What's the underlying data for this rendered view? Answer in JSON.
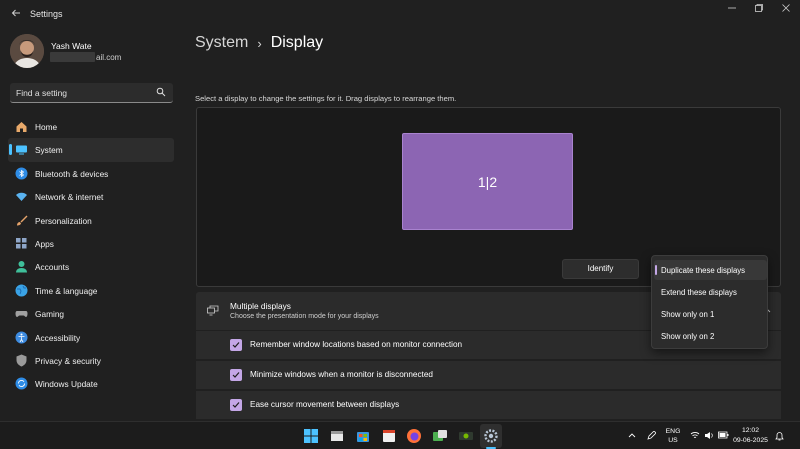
{
  "window": {
    "title": "Settings",
    "back_icon": "back-arrow-icon",
    "controls": [
      "minimize",
      "maximize",
      "close"
    ]
  },
  "profile": {
    "name": "Yash Wate",
    "email": "ail.com"
  },
  "search": {
    "placeholder": "Find a setting",
    "value": ""
  },
  "sidebar": {
    "items": [
      {
        "label": "Home",
        "icon": "home-icon",
        "color": "#e8a96a"
      },
      {
        "label": "System",
        "icon": "system-icon",
        "color": "#4cc2ff",
        "active": true
      },
      {
        "label": "Bluetooth & devices",
        "icon": "bluetooth-icon",
        "color": "#2e8ce6"
      },
      {
        "label": "Network & internet",
        "icon": "network-icon",
        "color": "#5ab3f0"
      },
      {
        "label": "Personalization",
        "icon": "brush-icon",
        "color": "#e6a46b"
      },
      {
        "label": "Apps",
        "icon": "apps-icon",
        "color": "#8ea6c8"
      },
      {
        "label": "Accounts",
        "icon": "accounts-icon",
        "color": "#3fbf9a"
      },
      {
        "label": "Time & language",
        "icon": "globe-icon",
        "color": "#3aa3e6"
      },
      {
        "label": "Gaming",
        "icon": "gaming-icon",
        "color": "#a0a0a0"
      },
      {
        "label": "Accessibility",
        "icon": "accessibility-icon",
        "color": "#3d8be0"
      },
      {
        "label": "Privacy & security",
        "icon": "shield-icon",
        "color": "#9a9a9a"
      },
      {
        "label": "Windows Update",
        "icon": "update-icon",
        "color": "#2e8ce6"
      }
    ]
  },
  "breadcrumb": {
    "parent": "System",
    "separator": "›",
    "current": "Display"
  },
  "main": {
    "instructions": "Select a display to change the settings for it. Drag displays to rearrange them.",
    "monitor_label": "1|2",
    "identify_label": "Identify",
    "accent": "#8c65b3"
  },
  "multiple_displays": {
    "title": "Multiple displays",
    "subtitle": "Choose the presentation mode for your displays"
  },
  "dropdown": {
    "options": [
      {
        "label": "Duplicate these displays",
        "selected": true
      },
      {
        "label": "Extend these displays",
        "selected": false
      },
      {
        "label": "Show only on 1",
        "selected": false
      },
      {
        "label": "Show only on 2",
        "selected": false
      }
    ]
  },
  "checkboxes": [
    {
      "label": "Remember window locations based on monitor connection",
      "checked": true
    },
    {
      "label": "Minimize windows when a monitor is disconnected",
      "checked": true
    },
    {
      "label": "Ease cursor movement between displays",
      "checked": true
    }
  ],
  "taskbar": {
    "apps": [
      "windows-start-icon",
      "file-explorer-icon",
      "microsoft-store-icon",
      "calendar-icon",
      "firefox-icon",
      "chat-app-icon",
      "gpu-app-icon",
      "settings-icon"
    ],
    "language_line1": "ENG",
    "language_line2": "US",
    "time": "12:02",
    "date": "09-06-2025"
  }
}
